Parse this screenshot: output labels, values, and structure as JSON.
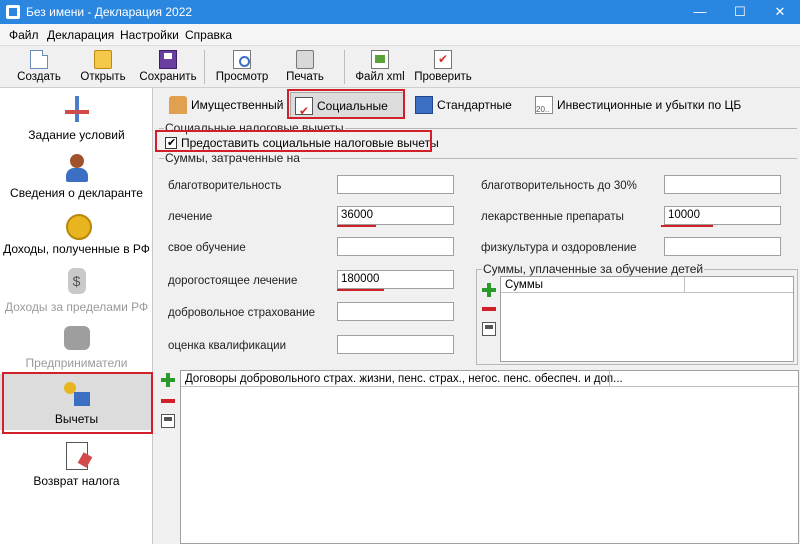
{
  "window": {
    "title": "Без имени - Декларация 2022",
    "minimize": "—",
    "maximize": "☐",
    "close": "✕"
  },
  "menu": [
    "Файл",
    "Декларация",
    "Настройки",
    "Справка"
  ],
  "toolbar": {
    "create": "Создать",
    "open": "Открыть",
    "save": "Сохранить",
    "preview": "Просмотр",
    "print": "Печать",
    "xml": "Файл xml",
    "check": "Проверить"
  },
  "sidebar": {
    "conditions": "Задание условий",
    "declarant": "Сведения о декларанте",
    "income_rf": "Доходы, полученные в РФ",
    "income_abroad": "Доходы за пределами РФ",
    "entrepreneurs": "Предприниматели",
    "deductions": "Вычеты",
    "tax_return": "Возврат налога"
  },
  "tabs": {
    "property": "Имущественный",
    "social": "Социальные",
    "standard": "Стандартные",
    "investment": "Инвестиционные и убытки по ЦБ",
    "investment_icon_text": "20.."
  },
  "social": {
    "group_title": "Социальные налоговые вычеты",
    "checkbox_label": "Предоставить социальные налоговые вычеты",
    "checked": true,
    "sums_title": "Суммы, затраченные на",
    "fields_left": [
      {
        "label": "благотворительность",
        "value": ""
      },
      {
        "label": "лечение",
        "value": "36000"
      },
      {
        "label": "свое обучение",
        "value": ""
      },
      {
        "label": "дорогостоящее лечение",
        "value": "180000"
      },
      {
        "label": "добровольное страхование",
        "value": ""
      },
      {
        "label": "оценка квалификации",
        "value": ""
      }
    ],
    "fields_right": [
      {
        "label": "благотворительность до 30%",
        "value": ""
      },
      {
        "label": "лекарственные препараты",
        "value": "10000"
      },
      {
        "label": "физкультура и оздоровление",
        "value": ""
      }
    ],
    "kids_title": "Суммы, уплаченные за обучение детей",
    "kids_column": "Суммы",
    "contracts_column": "Договоры добровольного страх. жизни, пенс. страх., негос. пенс. обеспеч. и доп..."
  },
  "colors": {
    "highlight": "#d0202a",
    "titlebar": "#2b86e0"
  }
}
